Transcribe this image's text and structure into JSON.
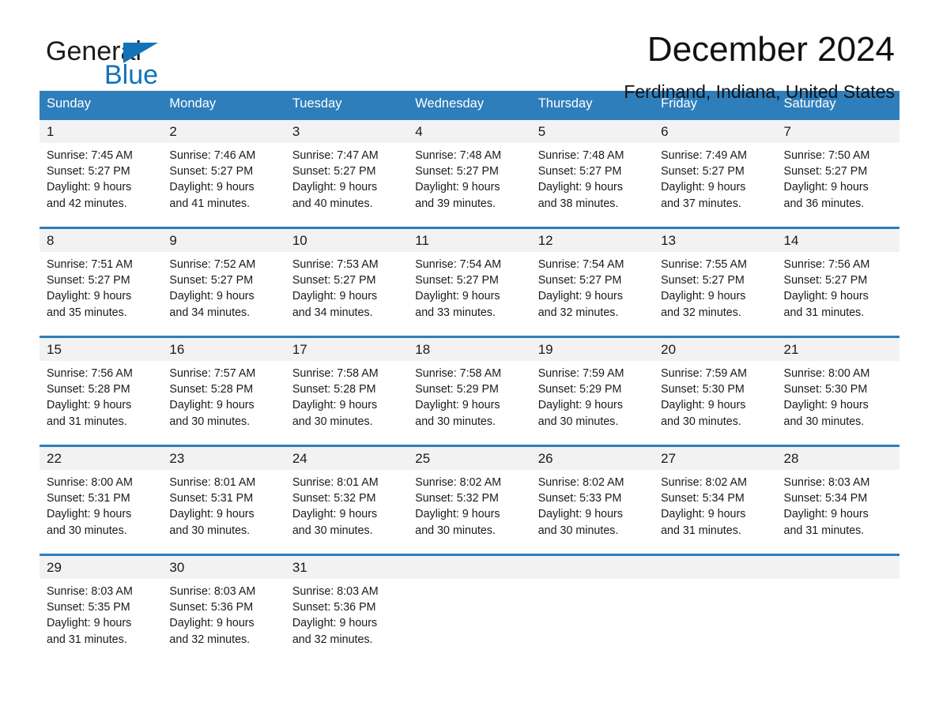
{
  "logo": {
    "word1": "General",
    "word2": "Blue",
    "triangle_color": "#1273b8",
    "blue_color": "#1273b8"
  },
  "header": {
    "title": "December 2024",
    "subtitle": "Ferdinand, Indiana, United States"
  },
  "theme": {
    "header_bg": "#2e7ebb",
    "header_text": "#ffffff",
    "daynum_bg": "#f2f2f2",
    "row_border": "#2e7ebb"
  },
  "calendar": {
    "day_headers": [
      "Sunday",
      "Monday",
      "Tuesday",
      "Wednesday",
      "Thursday",
      "Friday",
      "Saturday"
    ],
    "weeks": [
      [
        {
          "day": "1",
          "sunrise": "Sunrise: 7:45 AM",
          "sunset": "Sunset: 5:27 PM",
          "daylight1": "Daylight: 9 hours",
          "daylight2": "and 42 minutes."
        },
        {
          "day": "2",
          "sunrise": "Sunrise: 7:46 AM",
          "sunset": "Sunset: 5:27 PM",
          "daylight1": "Daylight: 9 hours",
          "daylight2": "and 41 minutes."
        },
        {
          "day": "3",
          "sunrise": "Sunrise: 7:47 AM",
          "sunset": "Sunset: 5:27 PM",
          "daylight1": "Daylight: 9 hours",
          "daylight2": "and 40 minutes."
        },
        {
          "day": "4",
          "sunrise": "Sunrise: 7:48 AM",
          "sunset": "Sunset: 5:27 PM",
          "daylight1": "Daylight: 9 hours",
          "daylight2": "and 39 minutes."
        },
        {
          "day": "5",
          "sunrise": "Sunrise: 7:48 AM",
          "sunset": "Sunset: 5:27 PM",
          "daylight1": "Daylight: 9 hours",
          "daylight2": "and 38 minutes."
        },
        {
          "day": "6",
          "sunrise": "Sunrise: 7:49 AM",
          "sunset": "Sunset: 5:27 PM",
          "daylight1": "Daylight: 9 hours",
          "daylight2": "and 37 minutes."
        },
        {
          "day": "7",
          "sunrise": "Sunrise: 7:50 AM",
          "sunset": "Sunset: 5:27 PM",
          "daylight1": "Daylight: 9 hours",
          "daylight2": "and 36 minutes."
        }
      ],
      [
        {
          "day": "8",
          "sunrise": "Sunrise: 7:51 AM",
          "sunset": "Sunset: 5:27 PM",
          "daylight1": "Daylight: 9 hours",
          "daylight2": "and 35 minutes."
        },
        {
          "day": "9",
          "sunrise": "Sunrise: 7:52 AM",
          "sunset": "Sunset: 5:27 PM",
          "daylight1": "Daylight: 9 hours",
          "daylight2": "and 34 minutes."
        },
        {
          "day": "10",
          "sunrise": "Sunrise: 7:53 AM",
          "sunset": "Sunset: 5:27 PM",
          "daylight1": "Daylight: 9 hours",
          "daylight2": "and 34 minutes."
        },
        {
          "day": "11",
          "sunrise": "Sunrise: 7:54 AM",
          "sunset": "Sunset: 5:27 PM",
          "daylight1": "Daylight: 9 hours",
          "daylight2": "and 33 minutes."
        },
        {
          "day": "12",
          "sunrise": "Sunrise: 7:54 AM",
          "sunset": "Sunset: 5:27 PM",
          "daylight1": "Daylight: 9 hours",
          "daylight2": "and 32 minutes."
        },
        {
          "day": "13",
          "sunrise": "Sunrise: 7:55 AM",
          "sunset": "Sunset: 5:27 PM",
          "daylight1": "Daylight: 9 hours",
          "daylight2": "and 32 minutes."
        },
        {
          "day": "14",
          "sunrise": "Sunrise: 7:56 AM",
          "sunset": "Sunset: 5:27 PM",
          "daylight1": "Daylight: 9 hours",
          "daylight2": "and 31 minutes."
        }
      ],
      [
        {
          "day": "15",
          "sunrise": "Sunrise: 7:56 AM",
          "sunset": "Sunset: 5:28 PM",
          "daylight1": "Daylight: 9 hours",
          "daylight2": "and 31 minutes."
        },
        {
          "day": "16",
          "sunrise": "Sunrise: 7:57 AM",
          "sunset": "Sunset: 5:28 PM",
          "daylight1": "Daylight: 9 hours",
          "daylight2": "and 30 minutes."
        },
        {
          "day": "17",
          "sunrise": "Sunrise: 7:58 AM",
          "sunset": "Sunset: 5:28 PM",
          "daylight1": "Daylight: 9 hours",
          "daylight2": "and 30 minutes."
        },
        {
          "day": "18",
          "sunrise": "Sunrise: 7:58 AM",
          "sunset": "Sunset: 5:29 PM",
          "daylight1": "Daylight: 9 hours",
          "daylight2": "and 30 minutes."
        },
        {
          "day": "19",
          "sunrise": "Sunrise: 7:59 AM",
          "sunset": "Sunset: 5:29 PM",
          "daylight1": "Daylight: 9 hours",
          "daylight2": "and 30 minutes."
        },
        {
          "day": "20",
          "sunrise": "Sunrise: 7:59 AM",
          "sunset": "Sunset: 5:30 PM",
          "daylight1": "Daylight: 9 hours",
          "daylight2": "and 30 minutes."
        },
        {
          "day": "21",
          "sunrise": "Sunrise: 8:00 AM",
          "sunset": "Sunset: 5:30 PM",
          "daylight1": "Daylight: 9 hours",
          "daylight2": "and 30 minutes."
        }
      ],
      [
        {
          "day": "22",
          "sunrise": "Sunrise: 8:00 AM",
          "sunset": "Sunset: 5:31 PM",
          "daylight1": "Daylight: 9 hours",
          "daylight2": "and 30 minutes."
        },
        {
          "day": "23",
          "sunrise": "Sunrise: 8:01 AM",
          "sunset": "Sunset: 5:31 PM",
          "daylight1": "Daylight: 9 hours",
          "daylight2": "and 30 minutes."
        },
        {
          "day": "24",
          "sunrise": "Sunrise: 8:01 AM",
          "sunset": "Sunset: 5:32 PM",
          "daylight1": "Daylight: 9 hours",
          "daylight2": "and 30 minutes."
        },
        {
          "day": "25",
          "sunrise": "Sunrise: 8:02 AM",
          "sunset": "Sunset: 5:32 PM",
          "daylight1": "Daylight: 9 hours",
          "daylight2": "and 30 minutes."
        },
        {
          "day": "26",
          "sunrise": "Sunrise: 8:02 AM",
          "sunset": "Sunset: 5:33 PM",
          "daylight1": "Daylight: 9 hours",
          "daylight2": "and 30 minutes."
        },
        {
          "day": "27",
          "sunrise": "Sunrise: 8:02 AM",
          "sunset": "Sunset: 5:34 PM",
          "daylight1": "Daylight: 9 hours",
          "daylight2": "and 31 minutes."
        },
        {
          "day": "28",
          "sunrise": "Sunrise: 8:03 AM",
          "sunset": "Sunset: 5:34 PM",
          "daylight1": "Daylight: 9 hours",
          "daylight2": "and 31 minutes."
        }
      ],
      [
        {
          "day": "29",
          "sunrise": "Sunrise: 8:03 AM",
          "sunset": "Sunset: 5:35 PM",
          "daylight1": "Daylight: 9 hours",
          "daylight2": "and 31 minutes."
        },
        {
          "day": "30",
          "sunrise": "Sunrise: 8:03 AM",
          "sunset": "Sunset: 5:36 PM",
          "daylight1": "Daylight: 9 hours",
          "daylight2": "and 32 minutes."
        },
        {
          "day": "31",
          "sunrise": "Sunrise: 8:03 AM",
          "sunset": "Sunset: 5:36 PM",
          "daylight1": "Daylight: 9 hours",
          "daylight2": "and 32 minutes."
        },
        {
          "day": "",
          "sunrise": "",
          "sunset": "",
          "daylight1": "",
          "daylight2": ""
        },
        {
          "day": "",
          "sunrise": "",
          "sunset": "",
          "daylight1": "",
          "daylight2": ""
        },
        {
          "day": "",
          "sunrise": "",
          "sunset": "",
          "daylight1": "",
          "daylight2": ""
        },
        {
          "day": "",
          "sunrise": "",
          "sunset": "",
          "daylight1": "",
          "daylight2": ""
        }
      ]
    ]
  }
}
